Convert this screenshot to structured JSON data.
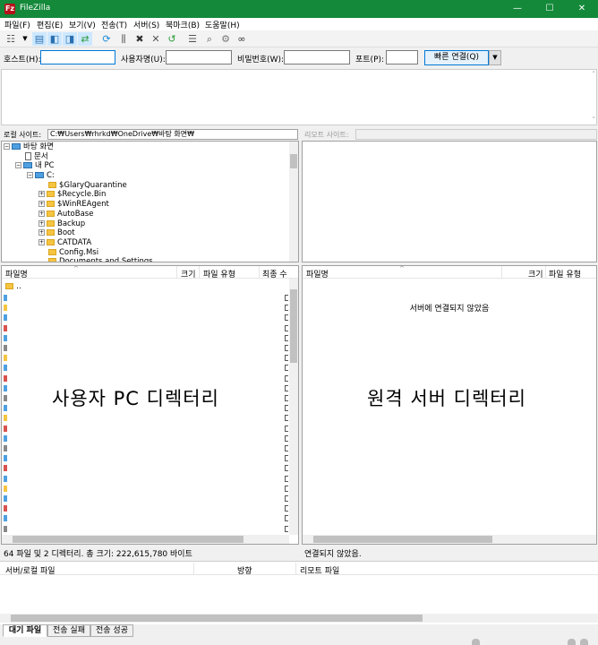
{
  "window": {
    "title": "FileZilla",
    "logo": "Fz",
    "minimize": "—",
    "maximize": "☐",
    "close": "✕"
  },
  "menu": [
    "파일(F)",
    "편집(E)",
    "보기(V)",
    "전송(T)",
    "서버(S)",
    "북마크(B)",
    "도움말(H)"
  ],
  "toolbar_icons": [
    "site-manager-icon",
    "toggle-log-icon",
    "toggle-local-tree-icon",
    "toggle-remote-tree-icon",
    "toggle-queue-icon",
    "refresh-icon",
    "process-queue-icon",
    "cancel-icon",
    "disconnect-icon",
    "reconnect-icon",
    "filter-icon",
    "search-icon",
    "compare-icon",
    "find-files-icon"
  ],
  "quickconnect": {
    "host_label": "호스트(H):",
    "user_label": "사용자명(U):",
    "pass_label": "비밀번호(W):",
    "port_label": "포트(P):",
    "button": "빠른 연결(Q)",
    "dropdown": "▼"
  },
  "local": {
    "site_label": "로컬 사이트:",
    "path": "C:₩Users₩rhrkd₩OneDrive₩바탕 화면₩",
    "tree": [
      {
        "label": "바탕 화면",
        "indent": 0,
        "expander": "−",
        "icon": "desktop-icon"
      },
      {
        "label": "문서",
        "indent": 1,
        "expander": "",
        "icon": "document-icon"
      },
      {
        "label": "내 PC",
        "indent": 1,
        "expander": "−",
        "icon": "pc-icon"
      },
      {
        "label": "C:",
        "indent": 2,
        "expander": "−",
        "icon": "drive-icon"
      },
      {
        "label": "$GlaryQuarantine",
        "indent": 3,
        "expander": "",
        "icon": "folder-icon"
      },
      {
        "label": "$Recycle.Bin",
        "indent": 3,
        "expander": "+",
        "icon": "folder-icon"
      },
      {
        "label": "$WinREAgent",
        "indent": 3,
        "expander": "+",
        "icon": "folder-icon"
      },
      {
        "label": "AutoBase",
        "indent": 3,
        "expander": "+",
        "icon": "folder-icon"
      },
      {
        "label": "Backup",
        "indent": 3,
        "expander": "+",
        "icon": "folder-icon"
      },
      {
        "label": "Boot",
        "indent": 3,
        "expander": "+",
        "icon": "folder-icon"
      },
      {
        "label": "CATDATA",
        "indent": 3,
        "expander": "+",
        "icon": "folder-icon"
      },
      {
        "label": "Config.Msi",
        "indent": 3,
        "expander": "",
        "icon": "folder-icon"
      },
      {
        "label": "Documents and Settings",
        "indent": 3,
        "expander": "",
        "icon": "folder-icon"
      }
    ],
    "columns": [
      "파일명",
      "크기",
      "파일 유형",
      "최종 수"
    ],
    "sort_arrow": "^",
    "first_row": "..",
    "overlay": "사용자 PC 디렉터리",
    "status": "64 파일 및 2 디렉터리. 총 크기: 222,615,780 바이트"
  },
  "remote": {
    "site_label": "리모트 사이트:",
    "columns": [
      "파일명",
      "크기",
      "파일 유형"
    ],
    "sort_arrow": "^",
    "not_connected": "서버에 연결되지 않았음",
    "overlay": "원격 서버 디렉터리",
    "status": "연결되지 않았음."
  },
  "queue": {
    "columns": [
      "서버/로컬 파일",
      "방향",
      "리모트 파일"
    ]
  },
  "tabs": [
    "대기 파일",
    "전송 실패",
    "전송 성공"
  ]
}
